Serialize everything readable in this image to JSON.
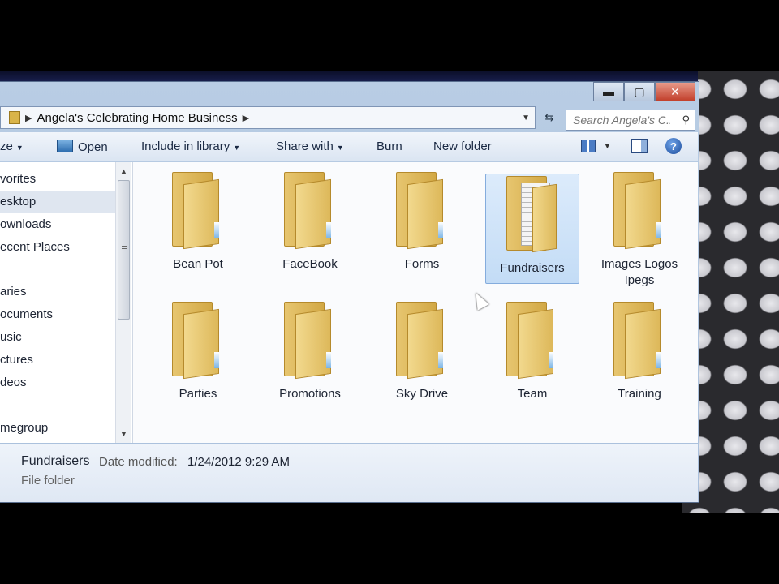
{
  "window": {
    "breadcrumb": "Angela's Celebrating Home Business",
    "search_placeholder": "Search Angela's C...",
    "caption": {
      "minimize": "▬",
      "maximize": "▢",
      "close": "✕"
    }
  },
  "toolbar": {
    "organize_label": "ze",
    "open_label": "Open",
    "include_label": "Include in library",
    "share_label": "Share with",
    "burn_label": "Burn",
    "new_folder_label": "New folder",
    "help_label": "?"
  },
  "sidebar": {
    "items": [
      {
        "label": "vorites"
      },
      {
        "label": "esktop",
        "selected": true
      },
      {
        "label": "ownloads"
      },
      {
        "label": "ecent Places"
      },
      {
        "label": "aries"
      },
      {
        "label": "ocuments"
      },
      {
        "label": "usic"
      },
      {
        "label": "ctures"
      },
      {
        "label": "deos"
      },
      {
        "label": "megroup"
      }
    ]
  },
  "folders": [
    {
      "name": "Bean Pot"
    },
    {
      "name": "FaceBook"
    },
    {
      "name": "Forms"
    },
    {
      "name": "Fundraisers",
      "selected": true
    },
    {
      "name": "Images Logos Ipegs"
    },
    {
      "name": "Parties"
    },
    {
      "name": "Promotions"
    },
    {
      "name": "Sky Drive"
    },
    {
      "name": "Team"
    },
    {
      "name": "Training"
    }
  ],
  "details": {
    "name": "Fundraisers",
    "date_label": "Date modified:",
    "date_value": "1/24/2012 9:29 AM",
    "type": "File folder"
  }
}
